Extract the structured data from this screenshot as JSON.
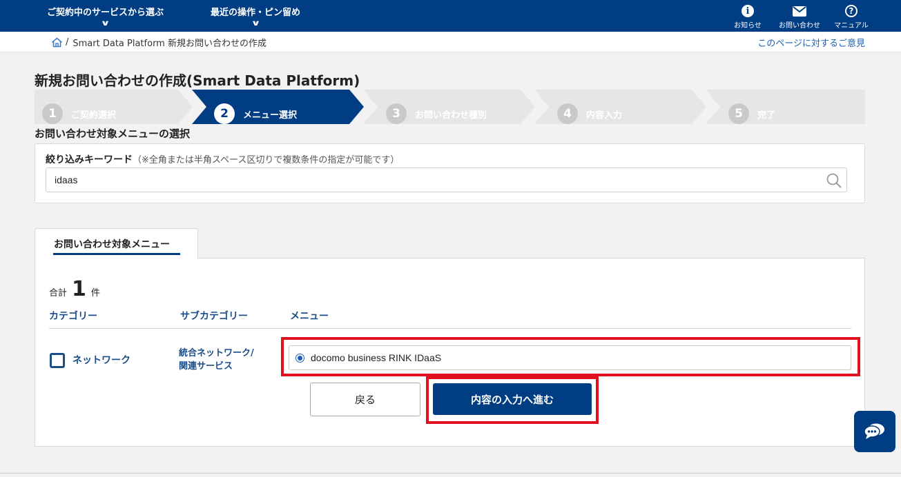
{
  "header": {
    "nav": [
      {
        "label": "ご契約中のサービスから選ぶ"
      },
      {
        "label": "最近の操作・ピン留め"
      }
    ],
    "icons": [
      {
        "label": "お知らせ",
        "icon": "info-icon"
      },
      {
        "label": "お問い合わせ",
        "icon": "mail-icon"
      },
      {
        "label": "マニュアル",
        "icon": "help-icon"
      }
    ],
    "colors": {
      "primary": "#003d82",
      "highlight": "#e0101e"
    }
  },
  "breadcrumb": {
    "separator": "/",
    "current": "Smart Data Platform 新規お問い合わせの作成",
    "feedback_link": "このページに対するご意見"
  },
  "page": {
    "title": "新規お問い合わせの作成(Smart Data Platform)"
  },
  "steps": [
    {
      "num": "1",
      "label": "ご契約選択",
      "state": "inactive"
    },
    {
      "num": "2",
      "label": "メニュー選択",
      "state": "active"
    },
    {
      "num": "3",
      "label": "お問い合わせ種別",
      "state": "inactive"
    },
    {
      "num": "4",
      "label": "内容入力",
      "state": "inactive"
    },
    {
      "num": "5",
      "label": "完了",
      "state": "inactive"
    }
  ],
  "section": {
    "title": "お問い合わせ対象メニューの選択"
  },
  "filter": {
    "label": "絞り込みキーワード",
    "note": "（※全角または半角スペース区切りで複数条件の指定が可能です）",
    "value": "idaas"
  },
  "tab": {
    "label": "お問い合わせ対象メニュー"
  },
  "results": {
    "total_prefix": "合計",
    "count": "1",
    "total_suffix": "件",
    "columns": [
      "カテゴリー",
      "サブカテゴリー",
      "メニュー"
    ],
    "rows": [
      {
        "category": "ネットワーク",
        "subcategory": "統合ネットワーク/\n関連サービス",
        "menu": "docomo business RINK IDaaS",
        "selected": true
      }
    ]
  },
  "actions": {
    "back_label": "戻る",
    "next_label": "内容の入力へ進む"
  }
}
